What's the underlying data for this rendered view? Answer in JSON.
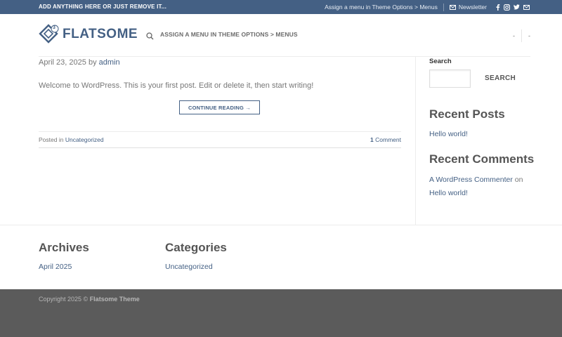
{
  "topbar": {
    "left_text": "ADD ANYTHING HERE OR JUST REMOVE IT...",
    "menu_text": "Assign a menu in Theme Options > Menus",
    "newsletter_label": "Newsletter",
    "social_icons": [
      "facebook-icon",
      "instagram-icon",
      "twitter-icon",
      "email-icon"
    ]
  },
  "header": {
    "logo_text": "FLATSOME",
    "logo_badge": "3",
    "menu_text": "ASSIGN A MENU IN THEME OPTIONS > MENUS",
    "right_item_1": "-",
    "right_item_2": "-"
  },
  "post": {
    "date": "April 23, 2025",
    "by": "by",
    "author": "admin",
    "excerpt": "Welcome to WordPress. This is your first post. Edit or delete it, then start writing!",
    "continue_label": "CONTINUE READING →",
    "posted_in_label": "Posted in",
    "category": "Uncategorized",
    "comment_count": "1",
    "comment_label": "Comment"
  },
  "sidebar": {
    "search_label": "Search",
    "search_button": "SEARCH",
    "recent_posts_title": "Recent Posts",
    "recent_posts": [
      "Hello world!"
    ],
    "recent_comments_title": "Recent Comments",
    "commenter": "A WordPress Commenter",
    "on_word": "on",
    "comment_post": "Hello world!"
  },
  "footer_widgets": {
    "archives_title": "Archives",
    "archives": [
      "April 2025"
    ],
    "categories_title": "Categories",
    "categories": [
      "Uncategorized"
    ]
  },
  "footer": {
    "copyright_prefix": "Copyright 2025 ©",
    "theme_name": "Flatsome Theme"
  },
  "colors": {
    "primary": "#446084",
    "footer_bg": "#5b5b5b",
    "text": "#777777"
  }
}
